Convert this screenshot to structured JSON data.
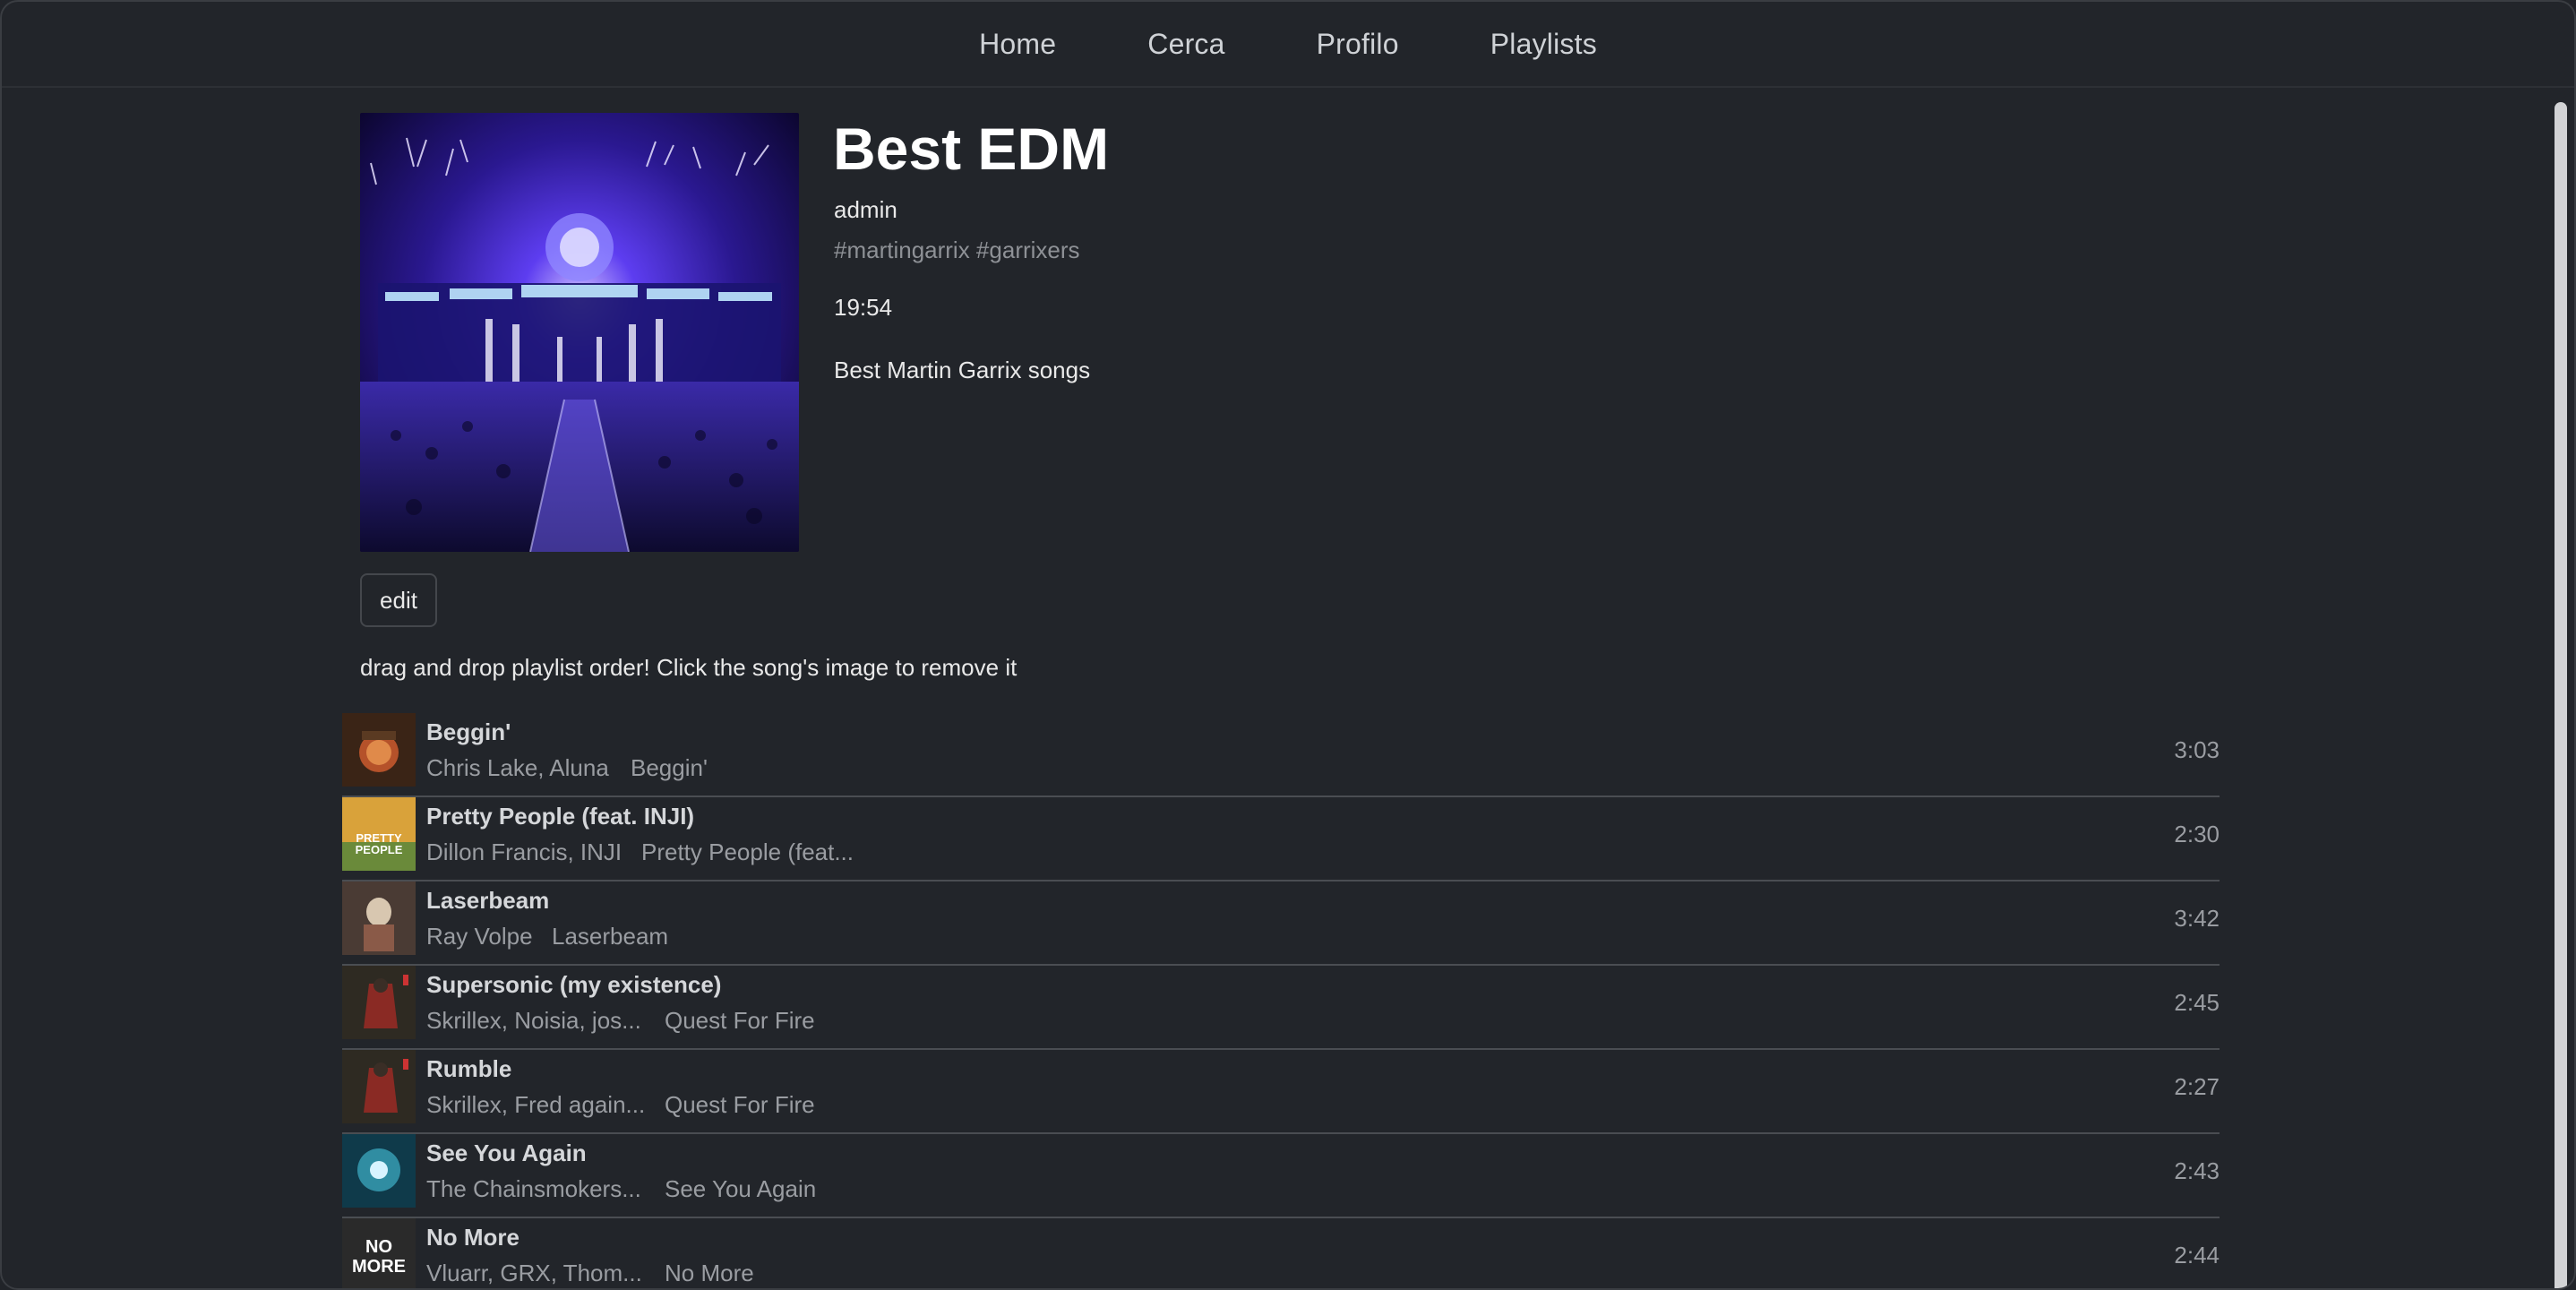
{
  "nav": {
    "items": [
      "Home",
      "Cerca",
      "Profilo",
      "Playlists"
    ]
  },
  "playlist": {
    "title": "Best EDM",
    "owner": "admin",
    "tags": "#martingarrix #garrixers",
    "duration": "19:54",
    "description": "Best Martin Garrix songs",
    "edit_label": "edit",
    "hint": "drag and drop playlist order! Click the song's image to remove it"
  },
  "songs": [
    {
      "title": "Beggin'",
      "artist": "Chris Lake, Aluna",
      "album": "Beggin'",
      "duration": "3:03"
    },
    {
      "title": "Pretty People (feat. INJI)",
      "artist": "Dillon Francis, INJI",
      "album": "Pretty People (feat...",
      "duration": "2:30"
    },
    {
      "title": "Laserbeam",
      "artist": "Ray Volpe",
      "album": "Laserbeam",
      "duration": "3:42"
    },
    {
      "title": "Supersonic (my existence)",
      "artist": "Skrillex, Noisia, jos...",
      "album": "Quest For Fire",
      "duration": "2:45"
    },
    {
      "title": "Rumble",
      "artist": "Skrillex, Fred again...",
      "album": "Quest For Fire",
      "duration": "2:27"
    },
    {
      "title": "See You Again",
      "artist": "The Chainsmokers...",
      "album": "See You Again",
      "duration": "2:43"
    },
    {
      "title": "No More",
      "artist": "Vluarr, GRX, Thom...",
      "album": "No More",
      "duration": "2:44"
    }
  ]
}
